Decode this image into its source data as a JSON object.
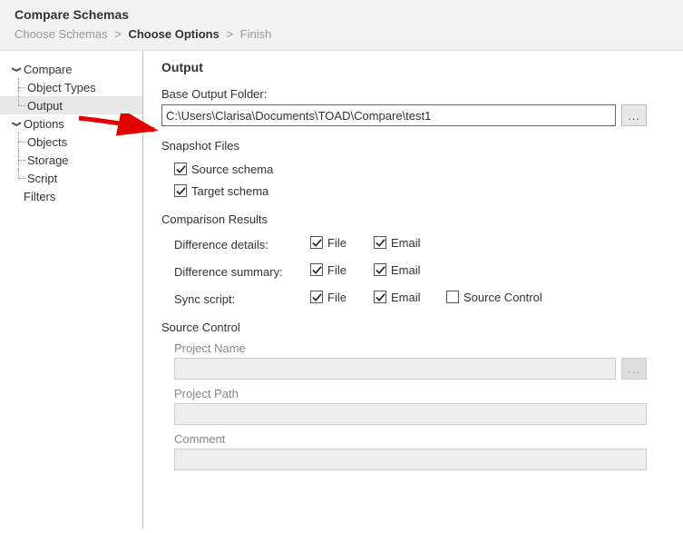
{
  "header": {
    "title": "Compare Schemas",
    "crumb1": "Choose Schemas",
    "crumb2": "Choose Options",
    "crumb3": "Finish",
    "sep": ">"
  },
  "sidebar": {
    "compare": "Compare",
    "object_types": "Object Types",
    "output": "Output",
    "options": "Options",
    "objects": "Objects",
    "storage": "Storage",
    "script": "Script",
    "filters": "Filters"
  },
  "main": {
    "title": "Output",
    "base_folder_label": "Base Output Folder:",
    "base_folder_value": "C:\\Users\\Clarisa\\Documents\\TOAD\\Compare\\test1",
    "browse": "...",
    "snapshot_title": "Snapshot Files",
    "snapshot_source": "Source schema",
    "snapshot_target": "Target schema",
    "results_title": "Comparison Results",
    "diff_details": "Difference details:",
    "diff_summary": "Difference summary:",
    "sync_script": "Sync script:",
    "cb_file": "File",
    "cb_email": "Email",
    "cb_source_control": "Source Control",
    "sc_title": "Source Control",
    "sc_project_name": "Project Name",
    "sc_project_path": "Project Path",
    "sc_comment": "Comment"
  }
}
